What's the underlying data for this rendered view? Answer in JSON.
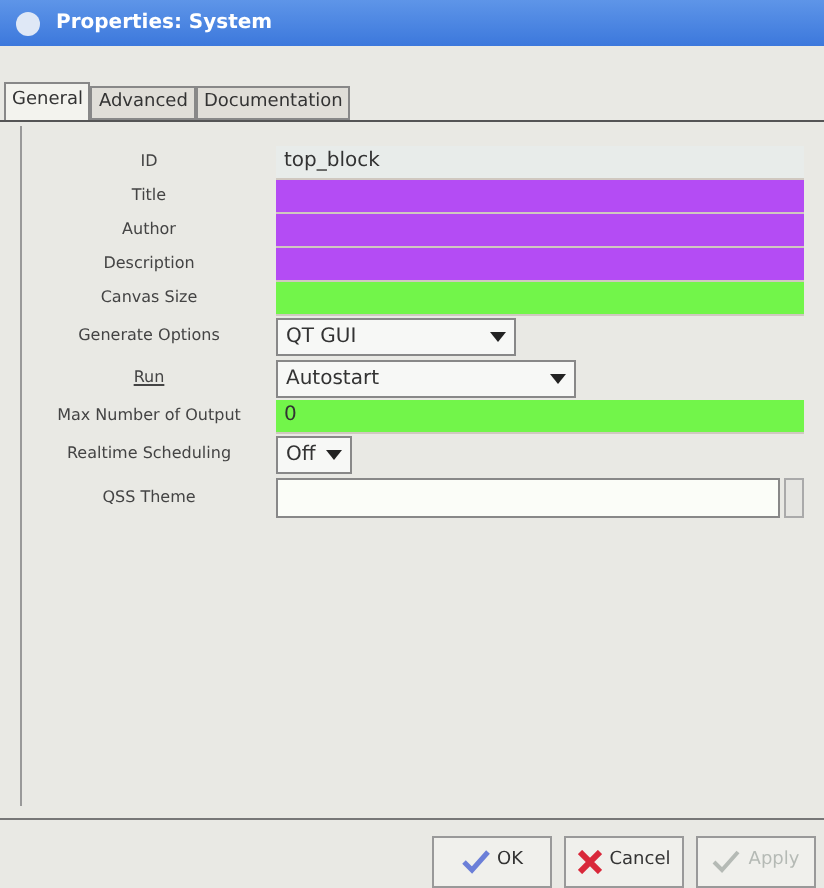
{
  "window": {
    "title": "Properties: System"
  },
  "tabs": [
    {
      "label": "General",
      "selected": true
    },
    {
      "label": "Advanced",
      "selected": false
    },
    {
      "label": "Documentation",
      "selected": false
    }
  ],
  "fields": [
    {
      "label": "ID",
      "kind": "text",
      "value": "top_block",
      "color": "#e8ecea",
      "underlined": false
    },
    {
      "label": "Title",
      "kind": "text",
      "color": "#b44cf4",
      "underlined": false
    },
    {
      "label": "Author",
      "kind": "text",
      "color": "#b44cf4",
      "underlined": false
    },
    {
      "label": "Description",
      "kind": "text",
      "color": "#b44cf4",
      "underlined": false
    },
    {
      "label": "Canvas Size",
      "kind": "text",
      "color": "#72f54a",
      "underlined": false
    },
    {
      "label": "Generate Options",
      "kind": "dropdown",
      "value": "QT GUI",
      "underlined": false
    },
    {
      "label": "Run",
      "kind": "dropdown",
      "value": "Autostart",
      "underlined": true
    },
    {
      "label": "Max Number of Output",
      "kind": "text",
      "value": "0",
      "color": "#72f54a",
      "underlined": false
    },
    {
      "label": "Realtime Scheduling",
      "kind": "dropdown",
      "value": "Off",
      "underlined": false
    },
    {
      "label": "QSS Theme",
      "kind": "file",
      "color": "#fbfdf8",
      "underlined": false
    }
  ],
  "buttons": [
    {
      "label": "OK",
      "kind": "ok",
      "disabled": false
    },
    {
      "label": "Cancel",
      "kind": "cancel",
      "disabled": false
    },
    {
      "label": "Apply",
      "kind": "apply",
      "disabled": true
    }
  ]
}
